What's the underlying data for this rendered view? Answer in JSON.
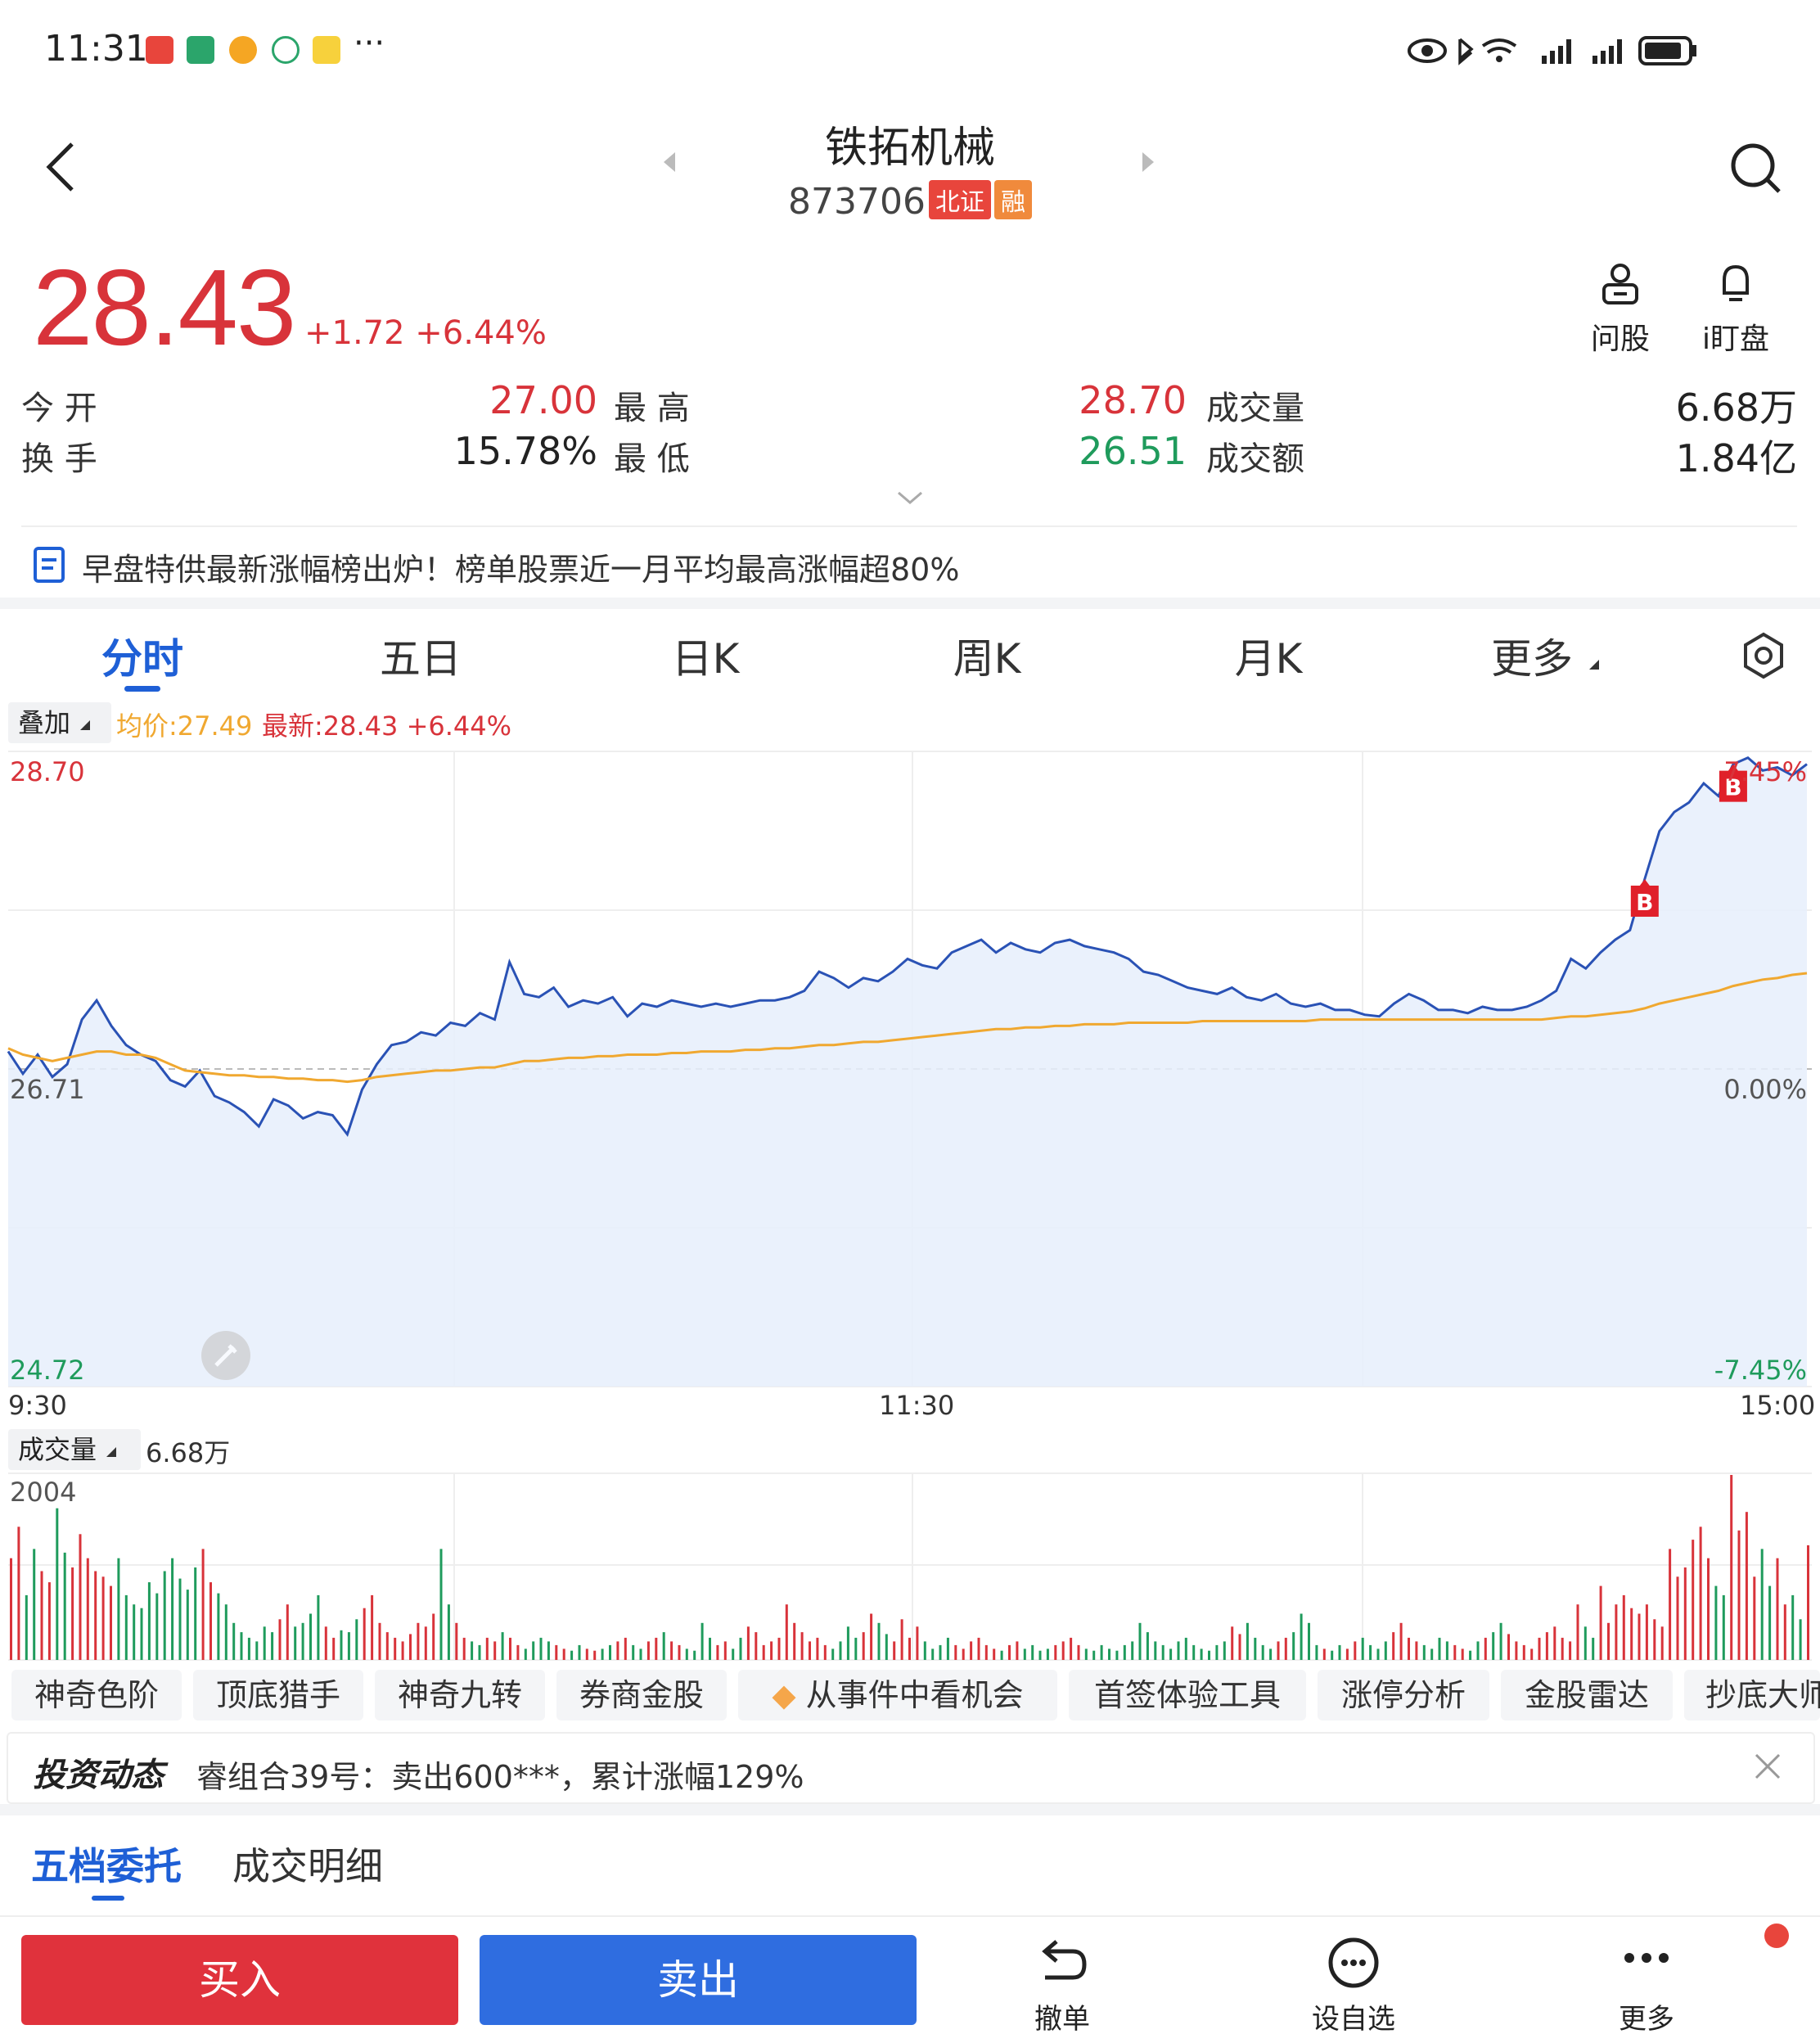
{
  "status_bar": {
    "time": "11:31",
    "more": "···"
  },
  "stock": {
    "name": "铁拓机械",
    "code": "873706",
    "tag_market": "北证",
    "tag_margin": "融",
    "price": "28.43",
    "change": "+1.72 +6.44%"
  },
  "actions": {
    "ask": "问股",
    "watch": "i盯盘"
  },
  "quote": {
    "open_label": "今 开",
    "open": "27.00",
    "high_label": "最 高",
    "high": "28.70",
    "vol_label": "成交量",
    "vol": "6.68万",
    "turnover_label": "换 手",
    "turnover": "15.78%",
    "low_label": "最 低",
    "low": "26.51",
    "amount_label": "成交额",
    "amount": "1.84亿"
  },
  "news": "早盘特供最新涨幅榜出炉！榜单股票近一月平均最高涨幅超80%",
  "tabs": [
    "分时",
    "五日",
    "日K",
    "周K",
    "月K",
    "更多"
  ],
  "chart_header": {
    "overlay": "叠加",
    "avg": "均价:27.49",
    "latest": "最新:28.43 +6.44%"
  },
  "chart_data": {
    "type": "line",
    "price_axis": {
      "top": "28.70",
      "mid": "26.71",
      "bottom": "24.72"
    },
    "pct_axis": {
      "top": "7.45%",
      "mid": "0.00%",
      "bottom": "-7.45%"
    },
    "time_axis": [
      "9:30",
      "11:30",
      "15:00"
    ],
    "ylim": [
      24.72,
      28.7
    ],
    "prev_close": 26.71,
    "markers": [
      "B",
      "B"
    ],
    "series": [
      {
        "name": "最新",
        "values": [
          26.82,
          26.68,
          26.8,
          26.66,
          26.74,
          27.02,
          27.14,
          26.98,
          26.86,
          26.8,
          26.76,
          26.64,
          26.6,
          26.7,
          26.54,
          26.5,
          26.44,
          26.35,
          26.52,
          26.48,
          26.4,
          26.44,
          26.42,
          26.3,
          26.58,
          26.74,
          26.86,
          26.88,
          26.94,
          26.92,
          27.0,
          26.98,
          27.06,
          27.02,
          27.38,
          27.18,
          27.16,
          27.22,
          27.1,
          27.14,
          27.12,
          27.16,
          27.04,
          27.12,
          27.1,
          27.14,
          27.12,
          27.1,
          27.12,
          27.1,
          27.12,
          27.14,
          27.14,
          27.16,
          27.2,
          27.32,
          27.28,
          27.22,
          27.28,
          27.26,
          27.32,
          27.4,
          27.36,
          27.34,
          27.44,
          27.48,
          27.52,
          27.44,
          27.5,
          27.46,
          27.44,
          27.5,
          27.52,
          27.48,
          27.46,
          27.44,
          27.4,
          27.32,
          27.3,
          27.26,
          27.22,
          27.2,
          27.18,
          27.22,
          27.16,
          27.14,
          27.18,
          27.12,
          27.1,
          27.12,
          27.08,
          27.08,
          27.05,
          27.04,
          27.12,
          27.18,
          27.14,
          27.08,
          27.08,
          27.06,
          27.1,
          27.08,
          27.08,
          27.1,
          27.14,
          27.2,
          27.4,
          27.34,
          27.44,
          27.52,
          27.58,
          27.9,
          28.2,
          28.32,
          28.38,
          28.5,
          28.42,
          28.62,
          28.66,
          28.58,
          28.6,
          28.55,
          28.62
        ]
      },
      {
        "name": "均价",
        "values": [
          26.84,
          26.8,
          26.78,
          26.76,
          26.78,
          26.8,
          26.82,
          26.82,
          26.8,
          26.8,
          26.78,
          26.74,
          26.7,
          26.69,
          26.68,
          26.67,
          26.67,
          26.66,
          26.66,
          26.65,
          26.65,
          26.64,
          26.64,
          26.63,
          26.64,
          26.66,
          26.67,
          26.68,
          26.69,
          26.7,
          26.7,
          26.71,
          26.72,
          26.72,
          26.74,
          26.76,
          26.76,
          26.77,
          26.78,
          26.78,
          26.79,
          26.79,
          26.8,
          26.8,
          26.8,
          26.81,
          26.81,
          26.82,
          26.82,
          26.82,
          26.83,
          26.83,
          26.84,
          26.84,
          26.85,
          26.86,
          26.86,
          26.87,
          26.88,
          26.88,
          26.89,
          26.9,
          26.91,
          26.92,
          26.93,
          26.94,
          26.95,
          26.96,
          26.96,
          26.97,
          26.97,
          26.98,
          26.98,
          26.99,
          26.99,
          26.99,
          27.0,
          27.0,
          27.0,
          27.0,
          27.0,
          27.01,
          27.01,
          27.01,
          27.01,
          27.01,
          27.01,
          27.01,
          27.01,
          27.02,
          27.02,
          27.02,
          27.02,
          27.02,
          27.02,
          27.02,
          27.02,
          27.02,
          27.02,
          27.02,
          27.02,
          27.02,
          27.02,
          27.02,
          27.02,
          27.03,
          27.04,
          27.04,
          27.05,
          27.06,
          27.07,
          27.09,
          27.12,
          27.14,
          27.16,
          27.18,
          27.2,
          27.23,
          27.25,
          27.27,
          27.28,
          27.3,
          27.31
        ]
      }
    ]
  },
  "volume": {
    "label": "成交量",
    "total": "6.68万",
    "max": "2004",
    "bars": [
      0.55,
      0.72,
      0.35,
      0.6,
      0.48,
      0.42,
      0.82,
      0.58,
      0.5,
      0.68,
      0.55,
      0.48,
      0.45,
      0.4,
      0.55,
      0.35,
      0.3,
      0.28,
      0.42,
      0.36,
      0.48,
      0.55,
      0.44,
      0.38,
      0.5,
      0.6,
      0.42,
      0.36,
      0.3,
      0.2,
      0.15,
      0.12,
      0.1,
      0.18,
      0.15,
      0.22,
      0.3,
      0.18,
      0.2,
      0.25,
      0.35,
      0.18,
      0.12,
      0.16,
      0.15,
      0.22,
      0.28,
      0.35,
      0.2,
      0.15,
      0.12,
      0.1,
      0.14,
      0.2,
      0.18,
      0.25,
      0.6,
      0.3,
      0.2,
      0.12,
      0.1,
      0.08,
      0.12,
      0.1,
      0.15,
      0.12,
      0.08,
      0.06,
      0.1,
      0.12,
      0.1,
      0.08,
      0.06,
      0.05,
      0.08,
      0.06,
      0.05,
      0.06,
      0.08,
      0.1,
      0.12,
      0.08,
      0.06,
      0.1,
      0.12,
      0.15,
      0.1,
      0.08,
      0.06,
      0.05,
      0.2,
      0.12,
      0.08,
      0.1,
      0.06,
      0.12,
      0.18,
      0.15,
      0.08,
      0.1,
      0.12,
      0.3,
      0.2,
      0.15,
      0.1,
      0.12,
      0.08,
      0.06,
      0.1,
      0.18,
      0.12,
      0.15,
      0.25,
      0.2,
      0.14,
      0.1,
      0.22,
      0.12,
      0.18,
      0.1,
      0.06,
      0.08,
      0.12,
      0.08,
      0.06,
      0.1,
      0.12,
      0.08,
      0.06,
      0.05,
      0.08,
      0.1,
      0.06,
      0.08,
      0.05,
      0.06,
      0.08,
      0.1,
      0.12,
      0.08,
      0.06,
      0.05,
      0.08,
      0.06,
      0.05,
      0.08,
      0.1,
      0.2,
      0.15,
      0.1,
      0.08,
      0.06,
      0.1,
      0.12,
      0.08,
      0.06,
      0.05,
      0.08,
      0.1,
      0.18,
      0.14,
      0.2,
      0.12,
      0.08,
      0.06,
      0.1,
      0.12,
      0.15,
      0.25,
      0.2,
      0.08,
      0.06,
      0.05,
      0.08,
      0.06,
      0.1,
      0.12,
      0.08,
      0.06,
      0.1,
      0.15,
      0.2,
      0.12,
      0.1,
      0.08,
      0.06,
      0.12,
      0.1,
      0.08,
      0.06,
      0.05,
      0.1,
      0.12,
      0.15,
      0.2,
      0.14,
      0.1,
      0.08,
      0.06,
      0.12,
      0.15,
      0.18,
      0.12,
      0.1,
      0.3,
      0.18,
      0.12,
      0.4,
      0.2,
      0.3,
      0.35,
      0.28,
      0.25,
      0.3,
      0.22,
      0.18,
      0.6,
      0.45,
      0.5,
      0.65,
      0.72,
      0.55,
      0.4,
      0.35,
      1.0,
      0.7,
      0.8,
      0.45,
      0.6,
      0.4,
      0.55,
      0.3,
      0.35,
      0.22,
      0.62
    ]
  },
  "tools": [
    "神奇色阶",
    "顶底猎手",
    "神奇九转",
    "券商金股",
    "从事件中看机会",
    "首签体验工具",
    "涨停分析",
    "金股雷达",
    "抄底大师"
  ],
  "invest": {
    "label": "投资动态",
    "text": "睿组合39号：卖出600***，累计涨幅129%"
  },
  "order_tabs": [
    "五档委托",
    "成交明细"
  ],
  "bottom": {
    "buy": "买入",
    "sell": "卖出",
    "cancel": "撤单",
    "watchlist": "设自选",
    "more": "更多"
  },
  "colors": {
    "up": "#d8333a",
    "down": "#1f9b5c",
    "accent": "#1e5fd6",
    "avg_line": "#f0a830",
    "price_line": "#2a52b5"
  }
}
